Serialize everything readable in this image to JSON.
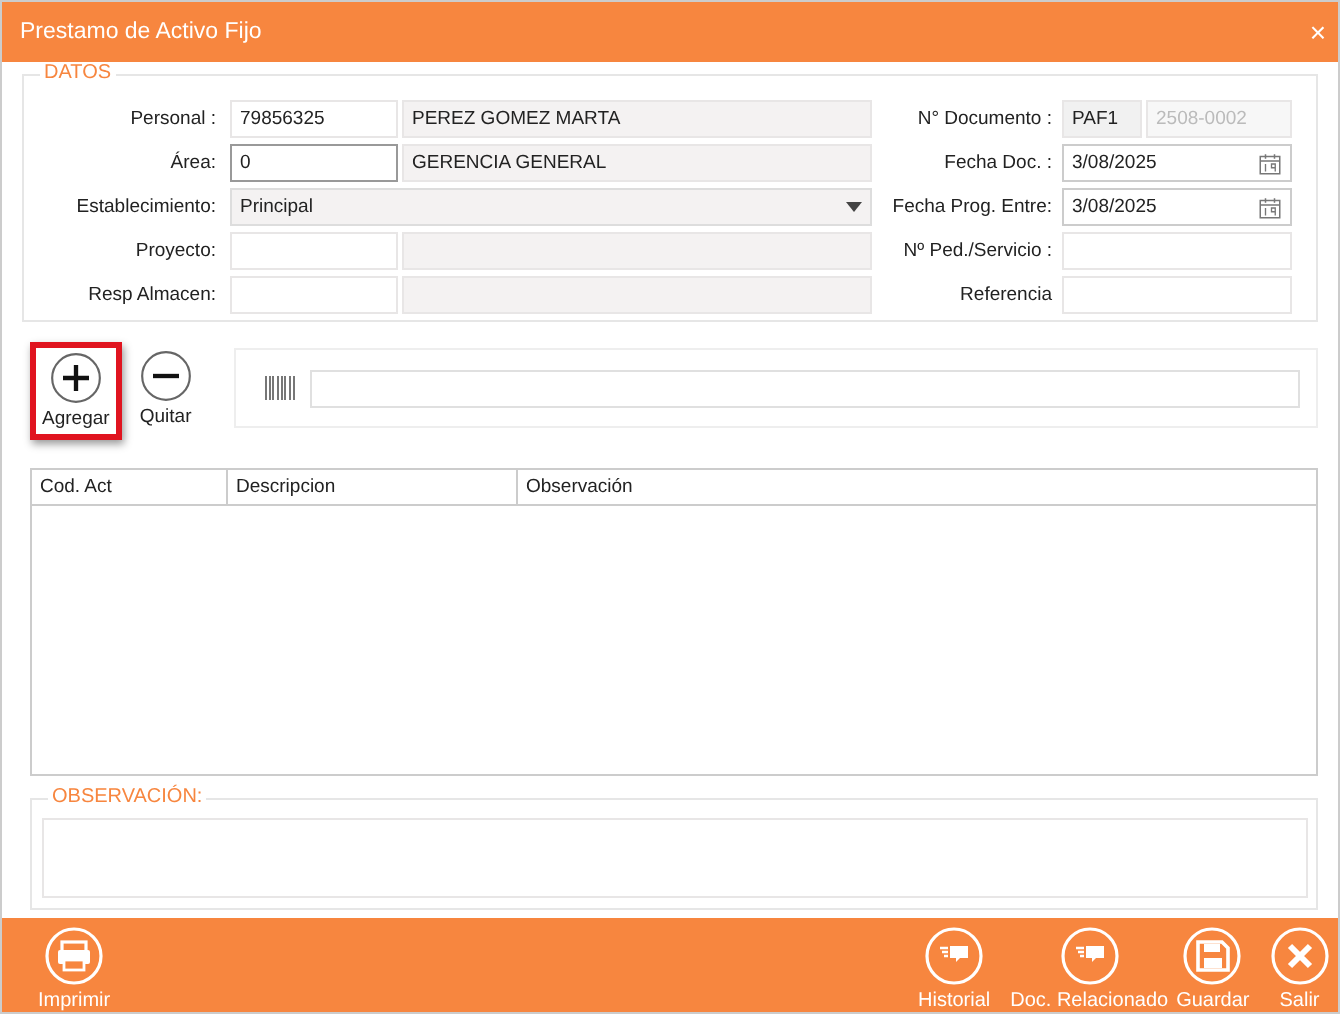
{
  "window": {
    "title": "Prestamo de Activo Fijo",
    "close": "×"
  },
  "datos": {
    "legend": "DATOS",
    "left_rows": [
      {
        "kind": "pair",
        "label": "Personal :",
        "code": "79856325",
        "name": "PEREZ GOMEZ MARTA",
        "code_focused": false
      },
      {
        "kind": "pair",
        "label": "Área:",
        "code": "0",
        "name": "GERENCIA GENERAL",
        "code_focused": true
      },
      {
        "kind": "combo",
        "label": "Establecimiento:",
        "value": "Principal"
      },
      {
        "kind": "pair",
        "label": "Proyecto:",
        "code_focused": false
      },
      {
        "kind": "pair",
        "label": "Resp Almacen:",
        "code_focused": false
      }
    ],
    "right_rows": [
      {
        "kind": "doc",
        "label": "N° Documento :",
        "series": "PAF1",
        "number": "2508-0002"
      },
      {
        "kind": "date",
        "label": "Fecha Doc. :",
        "value": "3/08/2025"
      },
      {
        "kind": "date",
        "label": "Fecha Prog. Entre:",
        "value": "3/08/2025"
      },
      {
        "kind": "text",
        "label": "Nº Ped./Servicio :"
      },
      {
        "kind": "text",
        "label": "Referencia"
      }
    ]
  },
  "actions": [
    {
      "kind": "add",
      "label": "Agregar",
      "highlighted": true
    },
    {
      "kind": "remove",
      "label": "Quitar",
      "highlighted": false
    }
  ],
  "table": {
    "columns": [
      "Cod. Act",
      "Descripcion",
      "Observación"
    ]
  },
  "observacion": {
    "legend": "OBSERVACIÓN:"
  },
  "footer": {
    "left": [
      {
        "kind": "print",
        "label": "Imprimir"
      }
    ],
    "center": [
      {
        "kind": "chat",
        "label": "Historial"
      },
      {
        "kind": "chat",
        "label": "Doc. Relacionado"
      }
    ],
    "right": [
      {
        "kind": "save",
        "label": "Guardar"
      },
      {
        "kind": "close",
        "label": "Salir"
      }
    ]
  }
}
